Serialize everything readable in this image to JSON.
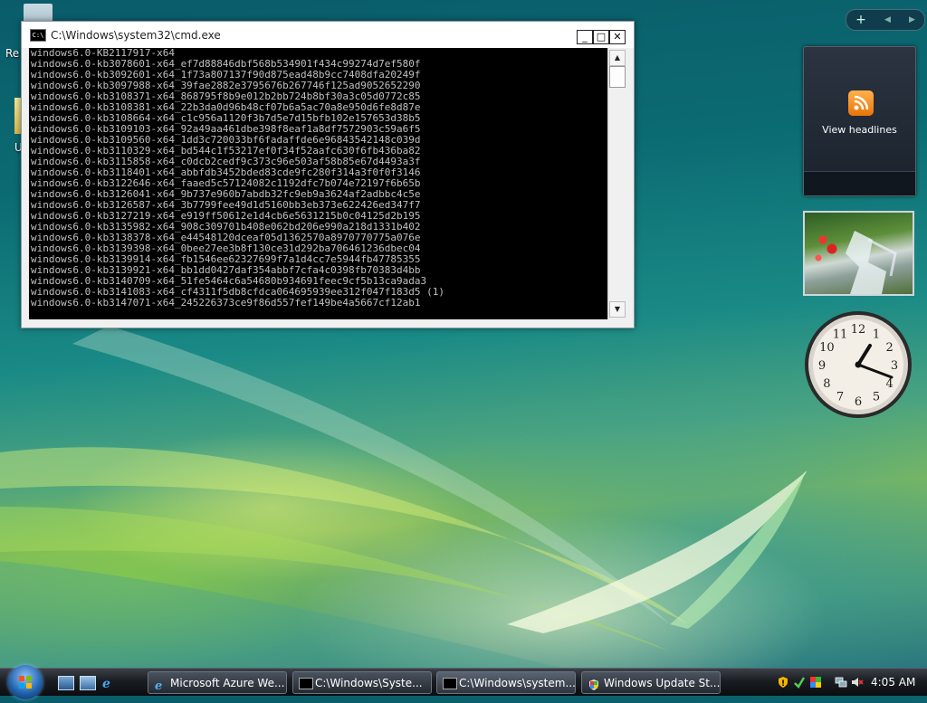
{
  "desktop": {
    "icons": [
      {
        "label": "Re",
        "name": "recycle-bin"
      },
      {
        "label": "U",
        "name": "desktop-item"
      }
    ]
  },
  "cmd_window": {
    "title": "C:\\Windows\\system32\\cmd.exe",
    "controls": {
      "minimize": "_",
      "maximize": "□",
      "close": "✕"
    },
    "lines": [
      "windows6.0-KB2117917-x64",
      "windows6.0-kb3078601-x64_ef7d88846dbf568b534901f434c99274d7ef580f",
      "windows6.0-kb3092601-x64_1f73a807137f90d875ead48b9cc7408dfa20249f",
      "windows6.0-kb3097988-x64_39fae2882e3795676b267746f125ad9052652290",
      "windows6.0-kb3108371-x64_868795f8b9e012b2bb724b8bf30a3c05d0772c85",
      "windows6.0-kb3108381-x64_22b3da0d96b48cf07b6a5ac70a8e950d6fe8d87e",
      "windows6.0-kb3108664-x64_c1c956a1120f3b7d5e7d15bfb102e157653d38b5",
      "windows6.0-kb3109103-x64_92a49aa461dbe398f8eaf1a8df7572903c59a6f5",
      "windows6.0-kb3109560-x64_1dd3c720033bf6fadaffde6e96843542148c039d",
      "windows6.0-kb3110329-x64_bd544c1f53217ef0f34f52aafc630f6fb436ba82",
      "windows6.0-kb3115858-x64_c0dcb2cedf9c373c96e503af58b85e67d4493a3f",
      "windows6.0-kb3118401-x64_abbfdb3452bded83cde9fc280f314a3f0f0f3146",
      "windows6.0-kb3122646-x64_faaed5c57124082c1192dfc7b074e72197f6b65b",
      "windows6.0-kb3126041-x64_9b737e960b7abdb32fc9eb9a3624af2adbbc4c5e",
      "windows6.0-kb3126587-x64_3b7799fee49d1d5160bb3eb373e622426ed347f7",
      "windows6.0-kb3127219-x64_e919ff50612e1d4cb6e5631215b0c04125d2b195",
      "windows6.0-kb3135982-x64_908c309701b408e062bd206e990a218d1331b402",
      "windows6.0-kb3138378-x64_e44548120dceaf05d1362570a8970770775a076e",
      "windows6.0-kb3139398-x64_0bee27ee3b8f130ce31d292ba706461236dbec04",
      "windows6.0-kb3139914-x64_fb1546ee62327699f7a1d4cc7e5944fb47785355",
      "windows6.0-kb3139921-x64_bb1dd0427daf354abbf7cfa4c0398fb70383d4bb",
      "windows6.0-kb3140709-x64_51fe5464c6a54680b934691feec9cf5b13ca9ada3",
      "windows6.0-kb3141083-x64_cf4311f5db8cfdca064695939ee312f047f183d5 (1)",
      "windows6.0-kb3147071-x64_245226373ce9f86d557fef149be4a5667cf12ab1"
    ]
  },
  "sidebar": {
    "toolbar": {
      "add": "+",
      "prev": "◀",
      "next": "▶"
    },
    "feed_gadget": {
      "label": "View headlines",
      "icon": "rss-icon"
    },
    "photo_gadget": {
      "icon": "slideshow-photo"
    },
    "clock_gadget": {
      "numbers": [
        "12",
        "1",
        "2",
        "3",
        "4",
        "5",
        "6",
        "7",
        "8",
        "9",
        "10",
        "11"
      ]
    }
  },
  "taskbar": {
    "start": "start-orb",
    "quick_launch": [
      "show-desktop-icon",
      "switch-windows-icon",
      "internet-explorer-icon"
    ],
    "buttons": [
      {
        "label": "Microsoft Azure We...",
        "icon": "ie-icon"
      },
      {
        "label": "C:\\Windows\\Syste...",
        "icon": "cmd-icon"
      },
      {
        "label": "C:\\Windows\\system...",
        "icon": "cmd-icon"
      },
      {
        "label": "Windows Update St...",
        "icon": "shield-icon"
      }
    ],
    "clock": "4:05 AM"
  }
}
